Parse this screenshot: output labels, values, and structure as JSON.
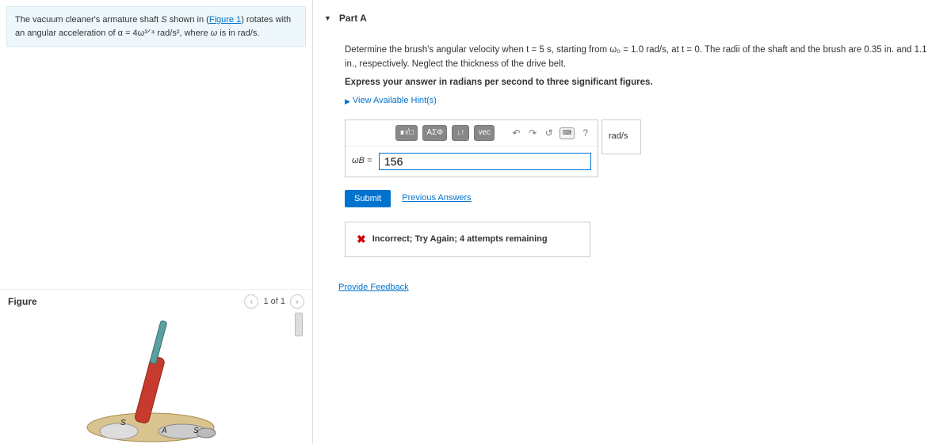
{
  "problem": {
    "text_pre": "The vacuum cleaner's armature shaft ",
    "shaft_var": "S",
    "text_mid1": " shown in (",
    "figure_link": "Figure 1",
    "text_mid2": ") rotates with an angular acceleration of ",
    "alpha_eq": "α = 4ω³ᐟ⁴ rad/s²",
    "text_mid3": ", where ",
    "omega_var": "ω",
    "text_mid4": " is in ",
    "units_rads": "rad/s",
    "text_end": "."
  },
  "figure": {
    "label": "Figure",
    "pager": "1 of 1"
  },
  "part": {
    "title": "Part A",
    "question": "Determine the brush's angular velocity when t = 5 s, starting from ω₀ = 1.0 rad/s, at t = 0. The radii of the shaft and the brush are 0.35 in. and 1.1 in., respectively. Neglect the thickness of the drive belt.",
    "instruction": "Express your answer in radians per second to three significant figures.",
    "hints_label": "View Available Hint(s)"
  },
  "toolbar": {
    "tpl": "∎√□",
    "greek": "ΑΣΦ",
    "frac": "↓↑",
    "vec": "vec",
    "undo": "↶",
    "redo": "↷",
    "reset": "↺",
    "kbd": "⌨",
    "help": "?"
  },
  "answer": {
    "prefix": "ωB =",
    "value": "156",
    "units": "rad/s"
  },
  "actions": {
    "submit": "Submit",
    "previous": "Previous Answers"
  },
  "feedback": {
    "text": "Incorrect; Try Again; 4 attempts remaining"
  },
  "links": {
    "provide_feedback": "Provide Feedback"
  }
}
